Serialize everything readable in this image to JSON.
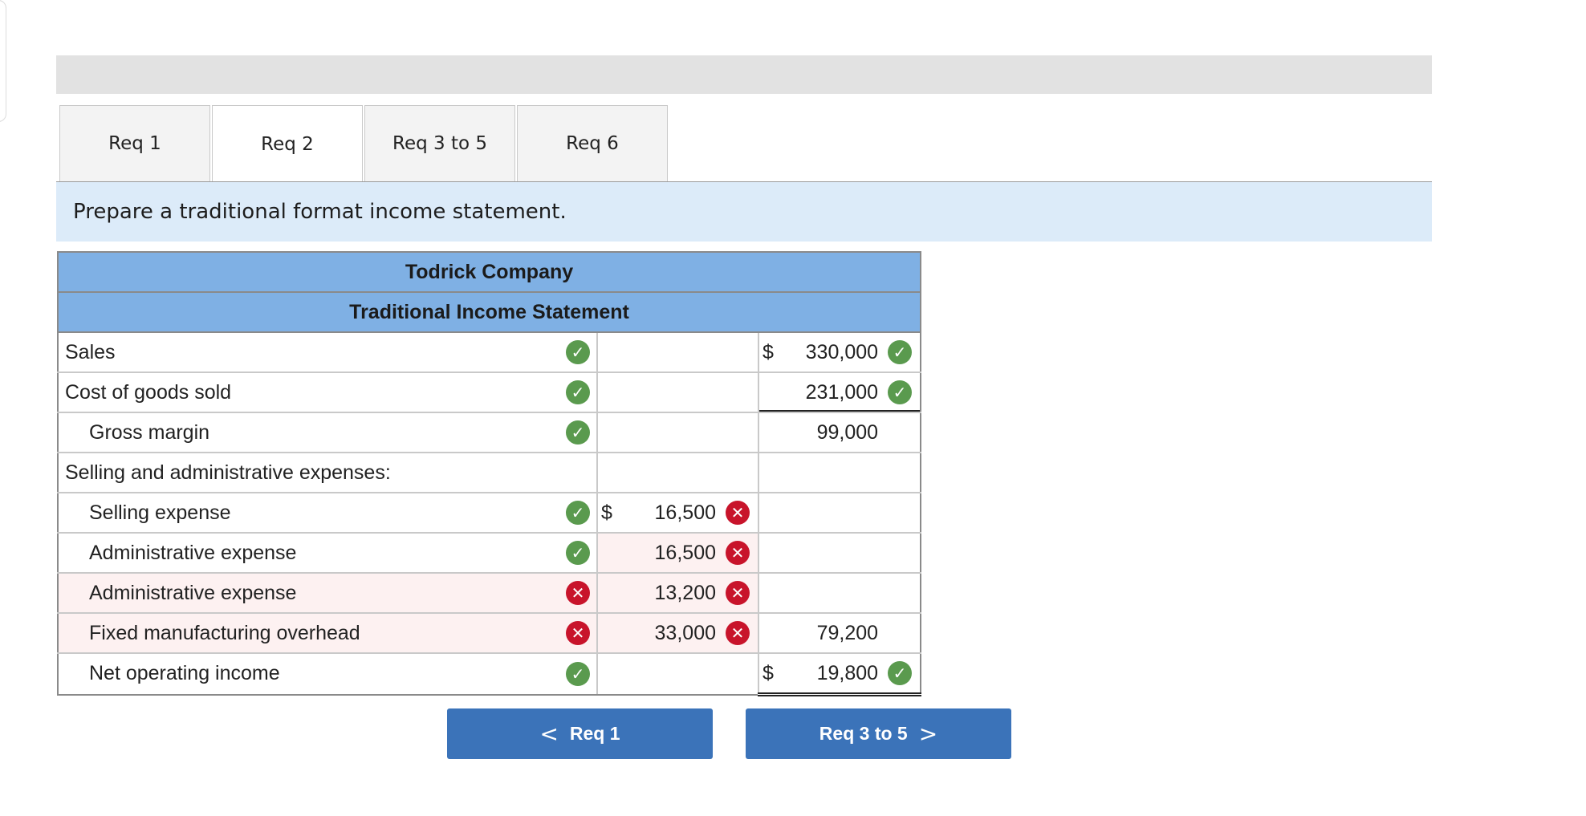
{
  "tabs": [
    {
      "label": "Req 1",
      "active": false
    },
    {
      "label": "Req 2",
      "active": true
    },
    {
      "label": "Req 3 to 5",
      "active": false
    },
    {
      "label": "Req 6",
      "active": false
    }
  ],
  "instruction": "Prepare a traditional format income statement.",
  "statement": {
    "company": "Todrick Company",
    "title": "Traditional Income Statement",
    "rows": [
      {
        "label": "Sales",
        "label_status": "correct",
        "col1_dollar": "",
        "col1_value": "",
        "col1_status": "",
        "col2_dollar": "$",
        "col2_value": "330,000",
        "col2_status": "correct"
      },
      {
        "label": "Cost of goods sold",
        "label_status": "correct",
        "col1_dollar": "",
        "col1_value": "",
        "col1_status": "",
        "col2_dollar": "",
        "col2_value": "231,000",
        "col2_status": "correct"
      },
      {
        "label": "Gross margin",
        "label_status": "correct",
        "col1_dollar": "",
        "col1_value": "",
        "col1_status": "",
        "col2_dollar": "",
        "col2_value": "99,000",
        "col2_status": ""
      },
      {
        "label": "Selling and administrative expenses:",
        "label_status": "",
        "col1_dollar": "",
        "col1_value": "",
        "col1_status": "",
        "col2_dollar": "",
        "col2_value": "",
        "col2_status": ""
      },
      {
        "label": "Selling expense",
        "label_status": "correct",
        "col1_dollar": "$",
        "col1_value": "16,500",
        "col1_status": "incorrect",
        "col2_dollar": "",
        "col2_value": "",
        "col2_status": ""
      },
      {
        "label": "Administrative expense",
        "label_status": "correct",
        "col1_dollar": "",
        "col1_value": "16,500",
        "col1_status": "incorrect",
        "col2_dollar": "",
        "col2_value": "",
        "col2_status": ""
      },
      {
        "label": "Administrative expense",
        "label_status": "incorrect",
        "col1_dollar": "",
        "col1_value": "13,200",
        "col1_status": "incorrect",
        "col2_dollar": "",
        "col2_value": "",
        "col2_status": ""
      },
      {
        "label": "Fixed manufacturing overhead",
        "label_status": "incorrect",
        "col1_dollar": "",
        "col1_value": "33,000",
        "col1_status": "incorrect",
        "col2_dollar": "",
        "col2_value": "79,200",
        "col2_status": ""
      },
      {
        "label": "Net operating income",
        "label_status": "correct",
        "col1_dollar": "",
        "col1_value": "",
        "col1_status": "",
        "col2_dollar": "$",
        "col2_value": "19,800",
        "col2_status": "correct"
      }
    ]
  },
  "nav": {
    "prev_label": "Req 1",
    "next_label": "Req 3 to 5",
    "prev_chevron": "<",
    "next_chevron": ">"
  },
  "marks": {
    "correct": "✓",
    "incorrect": "✕"
  },
  "colors": {
    "correct": "#5a9a4e",
    "incorrect": "#c8142b",
    "header": "#7fb0e4",
    "button": "#3b73b9"
  }
}
